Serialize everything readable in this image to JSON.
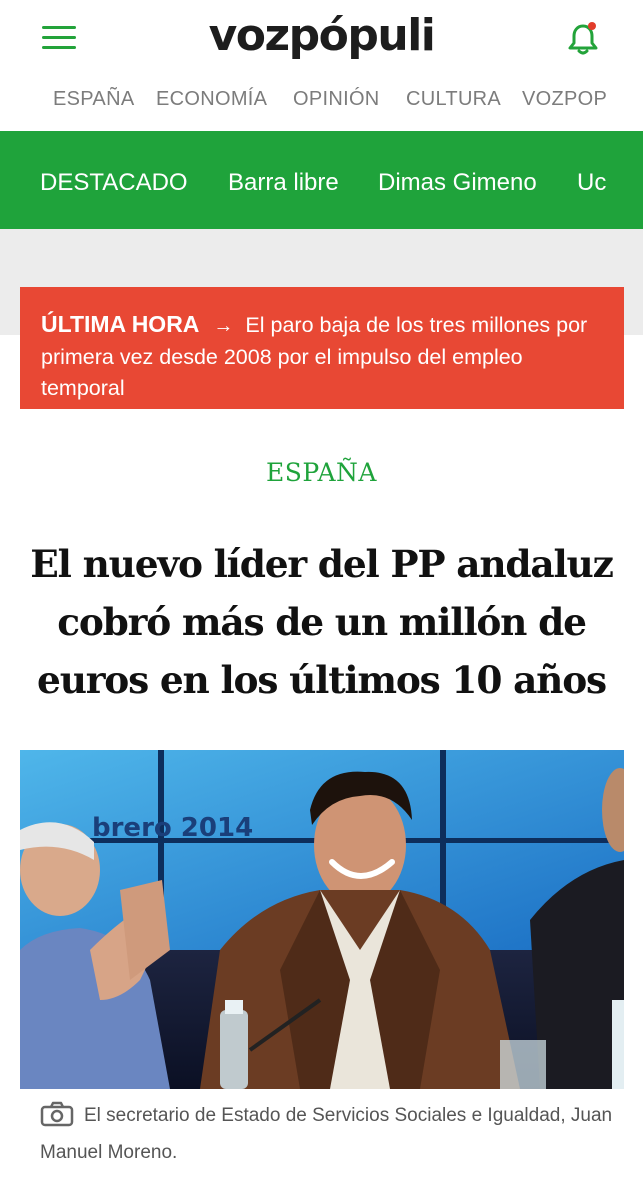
{
  "header": {
    "logo": "vozpópuli",
    "menu_icon": "hamburger-menu-icon",
    "notification_icon": "bell-icon",
    "accent_color": "#23a33a"
  },
  "section_nav": [
    "ESPAÑA",
    "ECONOMÍA",
    "OPINIÓN",
    "CULTURA",
    "VOZPOP"
  ],
  "featured_nav": [
    "DESTACADO",
    "Barra libre",
    "Dimas Gimeno",
    "Uc"
  ],
  "breaking": {
    "label": "ÚLTIMA HORA",
    "arrow": "→",
    "text": "El paro baja de los tres millones por primera vez desde 2008 por el impulso del empleo temporal",
    "color": "#e84834"
  },
  "article": {
    "category": "ESPAÑA",
    "headline": "El nuevo líder del PP andaluz cobró más de un millón de euros en los últimos 10 años",
    "photo_backdrop_text": "brero 2014",
    "caption": "El secretario de Estado de Servicios Sociales e Igualdad, Juan Manuel Moreno.",
    "caption_icon": "camera-icon"
  }
}
